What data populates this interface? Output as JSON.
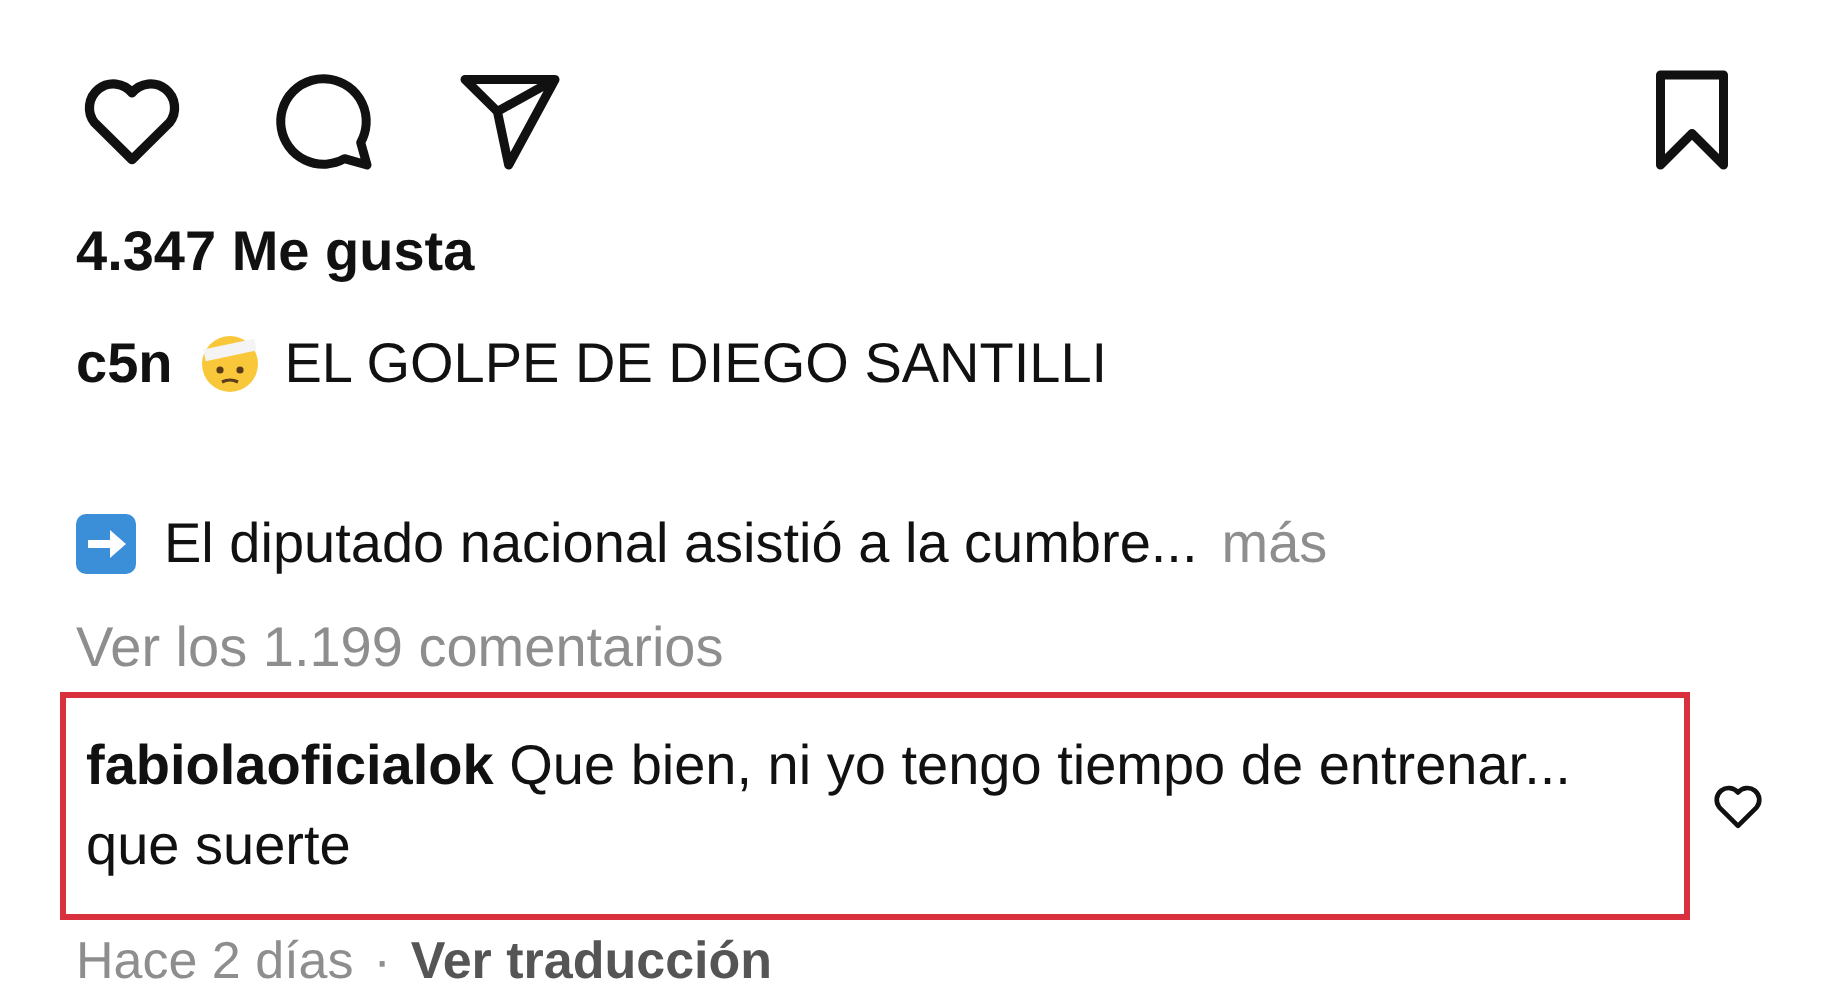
{
  "actions": {
    "liked": false,
    "saved": false
  },
  "likes": "4.347 Me gusta",
  "caption": {
    "username": "c5n",
    "headline": "EL GOLPE DE DIEGO SANTILLI",
    "text": "El diputado nacional asistió a la cumbre...",
    "more": "más"
  },
  "view_comments": "Ver los 1.199 comentarios",
  "comment": {
    "username": "fabiolaoficialok",
    "text": "Que bien, ni yo tengo tiempo de entrenar... que suerte",
    "highlighted": true,
    "liked": false,
    "time": "Hace 2 días",
    "separator": "·",
    "translate": "Ver traducción"
  }
}
